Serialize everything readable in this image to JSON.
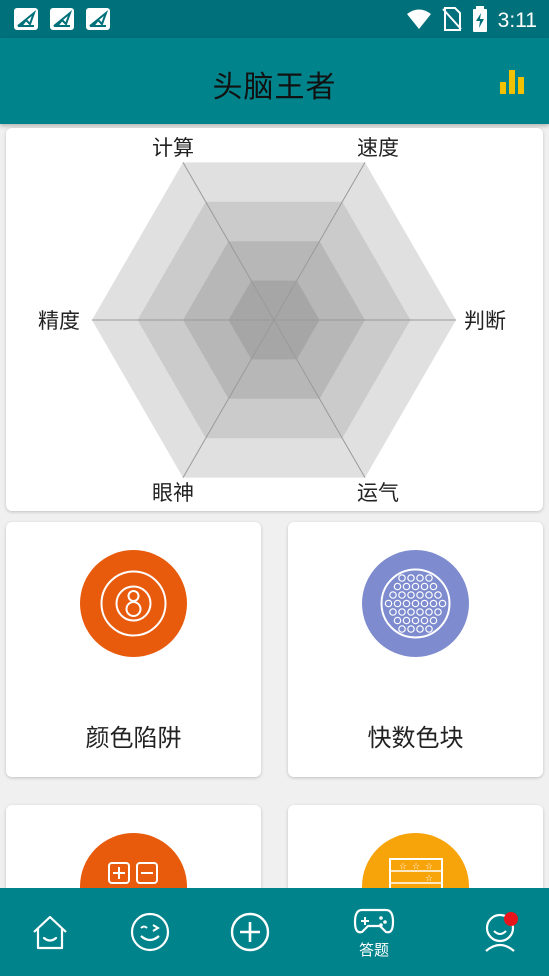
{
  "status_bar": {
    "time": "3:11",
    "notification_icons": [
      "app-notification-icon",
      "app-notification-icon",
      "app-notification-icon"
    ],
    "system_icons": [
      "wifi-icon",
      "no-sim-icon",
      "battery-charging-icon"
    ]
  },
  "header": {
    "title": "头脑王者",
    "action_icon": "bar-chart-icon",
    "action_color": "#f2c200"
  },
  "radar": {
    "axes": [
      "计算",
      "速度",
      "判断",
      "运气",
      "眼神",
      "精度"
    ],
    "levels": 4,
    "fill_colors": [
      "#e0e0e0",
      "#cbcbcb",
      "#b7b7b7",
      "#a6a6a6"
    ],
    "values": [
      0,
      0,
      0,
      0,
      0,
      0
    ]
  },
  "games": [
    {
      "title": "颜色陷阱",
      "icon": "eight-ball-icon",
      "color": "#e85a0c"
    },
    {
      "title": "快数色块",
      "icon": "golf-ball-icon",
      "color": "#7e8ccf"
    },
    {
      "title": "",
      "icon": "math-plus-minus-icon",
      "color": "#e85a0c"
    },
    {
      "title": "",
      "icon": "calendar-stars-icon",
      "color": "#f7a30a"
    }
  ],
  "bottom_nav": {
    "items": [
      {
        "icon": "home-icon",
        "label": ""
      },
      {
        "icon": "wink-face-icon",
        "label": ""
      },
      {
        "icon": "add-circle-icon",
        "label": ""
      },
      {
        "icon": "gamepad-icon",
        "label": "答题"
      },
      {
        "icon": "profile-icon",
        "label": ""
      }
    ],
    "badge_color": "#e8141b"
  }
}
